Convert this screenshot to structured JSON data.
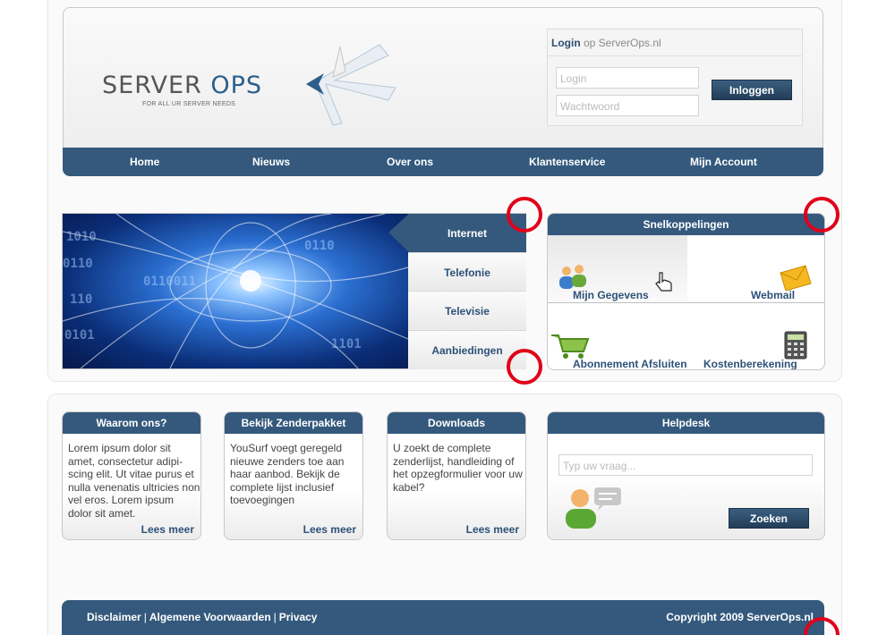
{
  "header": {
    "logo_word1": "SERVER",
    "logo_word2": "OPS",
    "logo_tagline": "FOR ALL UR SERVER NEEDS",
    "login": {
      "title_bold": "Login",
      "title_rest": "op ServerOps.nl",
      "login_placeholder": "Login",
      "password_placeholder": "Wachtwoord",
      "submit_label": "Inloggen"
    }
  },
  "nav": {
    "items": [
      "Home",
      "Nieuws",
      "Over ons",
      "Klantenservice",
      "Mijn Account"
    ]
  },
  "banner": {
    "tabs": [
      "Internet",
      "Telefonie",
      "Televisie",
      "Aanbiedingen"
    ],
    "active_tab": "Internet"
  },
  "quicklinks": {
    "title": "Snelkoppelingen",
    "items": [
      "Mijn Gegevens",
      "Webmail",
      "Abonnement Afsluiten",
      "Kostenberekening"
    ]
  },
  "info_boxes": [
    {
      "title": "Waarom ons?",
      "text": "Lorem ipsum dolor sit amet, consectetur adipi-scing elit. Ut vitae purus et nulla venenatis ultricies non vel eros. Lorem ipsum dolor sit amet.",
      "more": "Lees meer"
    },
    {
      "title": "Bekijk Zenderpakket",
      "text": "YouSurf voegt geregeld nieuwe zenders toe aan haar aanbod. Bekijk de complete lijst inclusief toevoegingen",
      "more": "Lees meer"
    },
    {
      "title": "Downloads",
      "text": "U zoekt de complete zenderlijst, handleiding of het opzegformulier voor uw kabel?",
      "more": "Lees meer"
    }
  ],
  "helpdesk": {
    "title": "Helpdesk",
    "placeholder": "Typ uw vraag...",
    "button": "Zoeken"
  },
  "footer": {
    "links": [
      "Disclaimer",
      "Algemene Voorwaarden",
      "Privacy"
    ],
    "separator": "|",
    "copyright": "Copyright 2009 ServerOps.nl"
  },
  "colors": {
    "primary": "#34597d",
    "link": "#2d5179",
    "marker": "#e0001a"
  }
}
